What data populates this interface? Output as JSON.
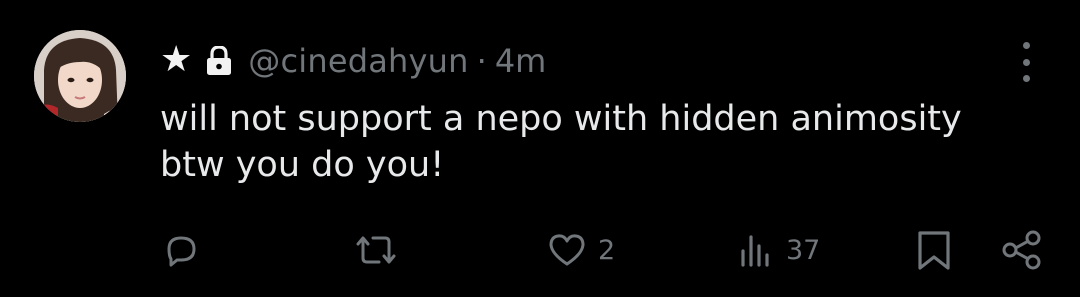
{
  "tweet": {
    "author": {
      "badge_icon": "star-icon",
      "badge_glyph": "★",
      "protected_icon": "lock-icon",
      "handle": "@cinedahyun",
      "separator": "·",
      "time": "4m"
    },
    "text_lines": [
      "will not support a nepo with hidden animosity",
      "btw you do you!"
    ],
    "actions": {
      "reply": {
        "icon": "reply-icon",
        "count": ""
      },
      "retweet": {
        "icon": "retweet-icon",
        "count": ""
      },
      "like": {
        "icon": "heart-icon",
        "count": "2"
      },
      "views": {
        "icon": "views-icon",
        "count": "37"
      },
      "bookmark": {
        "icon": "bookmark-icon"
      },
      "share": {
        "icon": "share-icon"
      }
    }
  },
  "colors": {
    "background": "#000000",
    "text_primary": "#e7e9ea",
    "text_secondary": "#71767b"
  }
}
